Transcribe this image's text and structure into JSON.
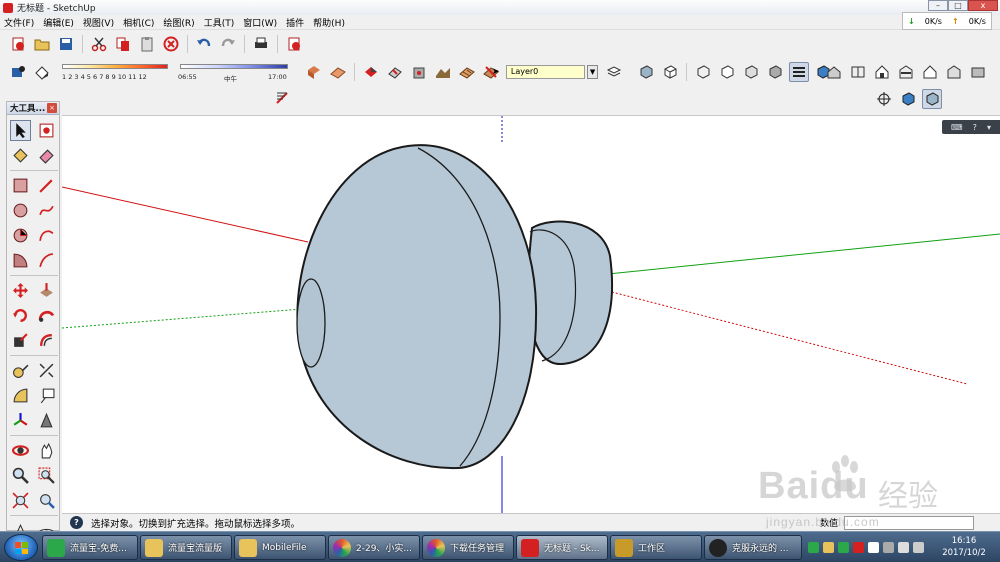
{
  "window": {
    "title": "无标题 - SketchUp",
    "buttons": [
      "–",
      "□",
      "x"
    ]
  },
  "speed_widget": {
    "down": "0K/s",
    "up": "0K/s"
  },
  "menubar": {
    "items": [
      "文件(F)",
      "编辑(E)",
      "视图(V)",
      "相机(C)",
      "绘图(R)",
      "工具(T)",
      "窗口(W)",
      "插件",
      "帮助(H)"
    ]
  },
  "shadow": {
    "month_ticks": "1  2  3  4  5  6  7  8  9  10 11 12",
    "time_start": "06:55",
    "time_mid": "中午",
    "time_end": "17:00"
  },
  "layer": {
    "current": "Layer0"
  },
  "palette": {
    "title": "大工具..."
  },
  "status": {
    "text": "选择对象。切换到扩充选择。拖动鼠标选择多项。",
    "vcb_label": "数值"
  },
  "taskbar": {
    "tasks": [
      {
        "label": "流量宝-免费...",
        "color": "#2aa84a"
      },
      {
        "label": "流量宝流量版",
        "color": "#e8c25a"
      },
      {
        "label": "MobileFile",
        "color": "#e8c25a"
      },
      {
        "label": "2-29、小实...",
        "color": "#e05a2a"
      },
      {
        "label": "下载任务管理",
        "color": "#e05a2a"
      },
      {
        "label": "无标题 - Sk...",
        "color": "#d42020"
      },
      {
        "label": "工作区",
        "color": "#c89a2a"
      },
      {
        "label": "克服永远的 ...",
        "color": "#222222"
      }
    ],
    "clock_time": "16:16",
    "clock_date": "2017/10/2"
  },
  "watermark": {
    "logo": "Baidu",
    "cn": "经验",
    "url": "jingyan.baidu.com"
  },
  "colors": {
    "axis_red": "#d01010",
    "axis_green": "#10a010",
    "axis_blue": "#1010d0",
    "model_face": "#b6c8d6",
    "model_edge": "#1a1a1a",
    "layer_field": "#ffffcc"
  }
}
